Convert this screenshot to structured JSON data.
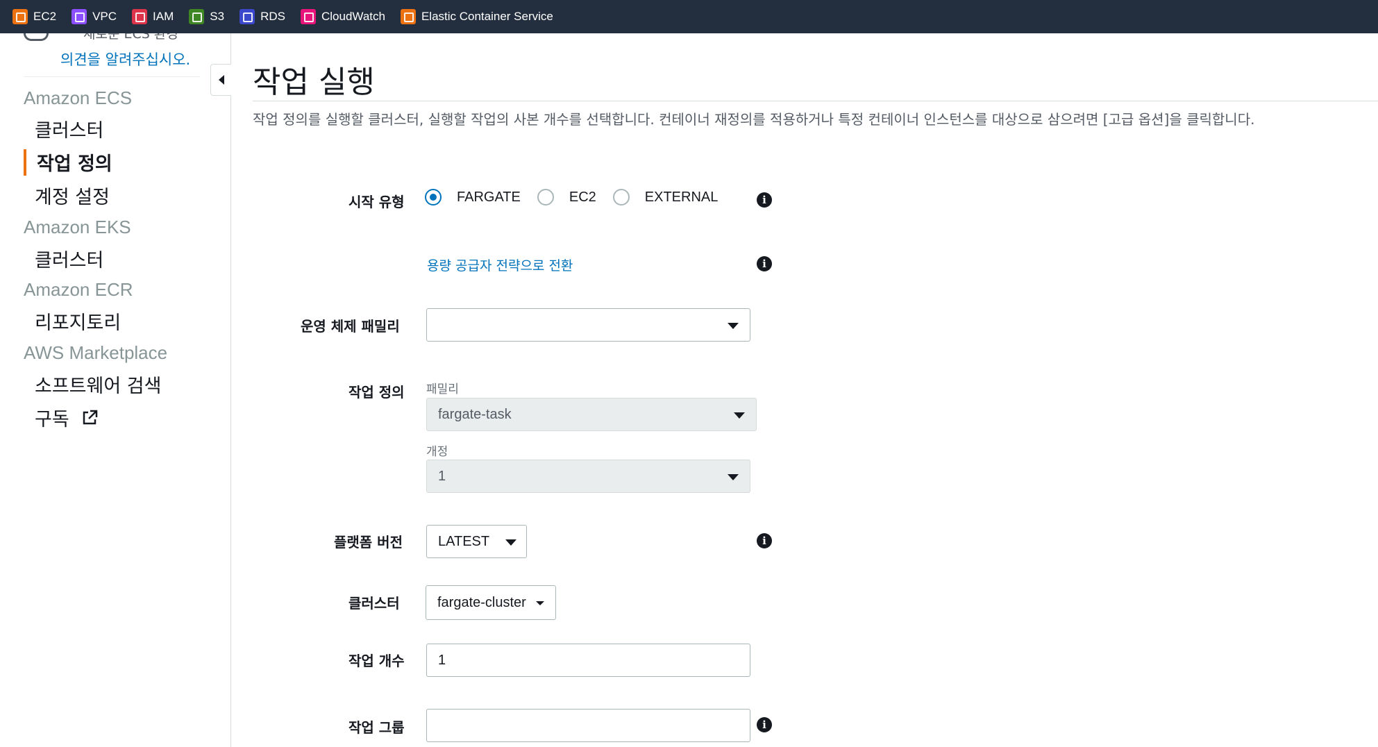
{
  "topbar": {
    "services": [
      {
        "label": "EC2",
        "color": "#ec7211",
        "icon": "ec2-icon"
      },
      {
        "label": "VPC",
        "color": "#8c4fff",
        "icon": "vpc-icon"
      },
      {
        "label": "IAM",
        "color": "#dd344c",
        "icon": "iam-icon"
      },
      {
        "label": "S3",
        "color": "#3f8624",
        "icon": "s3-icon"
      },
      {
        "label": "RDS",
        "color": "#3b48cc",
        "icon": "rds-icon"
      },
      {
        "label": "CloudWatch",
        "color": "#e7157b",
        "icon": "cloudwatch-icon"
      },
      {
        "label": "Elastic Container Service",
        "color": "#ec7211",
        "icon": "ecs-icon"
      }
    ]
  },
  "sidebar": {
    "toggle_text": "새로운 ECS 환경",
    "feedback_link": "의견을 알려주십시오.",
    "sections": [
      {
        "title": "Amazon ECS",
        "items": [
          "클러스터",
          "작업 정의",
          "계정 설정"
        ]
      },
      {
        "title": "Amazon EKS",
        "items": [
          "클러스터"
        ]
      },
      {
        "title": "Amazon ECR",
        "items": [
          "리포지토리"
        ]
      },
      {
        "title": "AWS Marketplace",
        "items": [
          "소프트웨어 검색",
          "구독"
        ]
      }
    ],
    "active_item": "작업 정의",
    "accent_color": "#ec7211"
  },
  "main": {
    "title": "작업 실행",
    "description": "작업 정의를 실행할 클러스터, 실행할 작업의 사본 개수를 선택합니다. 컨테이너 재정의를 적용하거나 특정 컨테이너 인스턴스를 대상으로 삼으려면 [고급 옵션]을 클릭합니다.",
    "launch_type": {
      "label": "시작 유형",
      "options": [
        "FARGATE",
        "EC2",
        "EXTERNAL"
      ],
      "selected": "FARGATE"
    },
    "capacity_link": "용량 공급자 전략으로 전환",
    "os_family": {
      "label": "운영 체제 패밀리",
      "value": ""
    },
    "task_definition": {
      "label": "작업 정의",
      "family_label": "패밀리",
      "family_value": "fargate-task",
      "revision_label": "개정",
      "revision_value": "1"
    },
    "platform_version": {
      "label": "플랫폼 버전",
      "value": "LATEST"
    },
    "cluster": {
      "label": "클러스터",
      "value": "fargate-cluster"
    },
    "task_count": {
      "label": "작업 개수",
      "value": "1"
    },
    "task_group": {
      "label": "작업 그룹",
      "value": ""
    },
    "link_color": "#0073bb"
  }
}
